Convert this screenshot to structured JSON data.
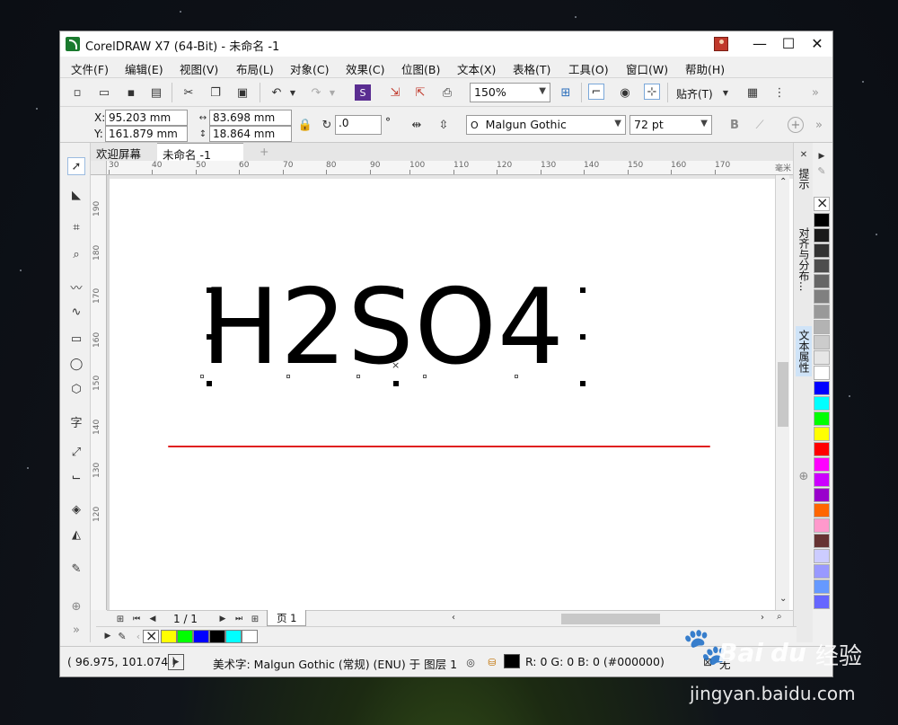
{
  "window": {
    "title": "CorelDRAW X7 (64-Bit) - 未命名 -1",
    "minimize": "—",
    "maximize": "☐",
    "close": "✕"
  },
  "menu": [
    "文件(F)",
    "编辑(E)",
    "视图(V)",
    "布局(L)",
    "对象(C)",
    "效果(C)",
    "位图(B)",
    "文本(X)",
    "表格(T)",
    "工具(O)",
    "窗口(W)",
    "帮助(H)"
  ],
  "toolbar": {
    "zoom": "150%",
    "snap_label": "贴齐(T)",
    "more": "»"
  },
  "propertybar": {
    "x_label": "X:",
    "x_value": "95.203 mm",
    "y_label": "Y:",
    "y_value": "161.879 mm",
    "width_value": "83.698 mm",
    "height_value": "18.864 mm",
    "rotation_value": ".0",
    "rotation_unit": "°",
    "font_name": "Malgun Gothic",
    "font_size": "72 pt"
  },
  "tabs": {
    "welcome": "欢迎屏幕",
    "document": "未命名 -1",
    "add": "+"
  },
  "ruler": {
    "unit": "毫米",
    "h_ticks": [
      "30",
      "40",
      "50",
      "60",
      "70",
      "80",
      "90",
      "100",
      "110",
      "120",
      "130",
      "140",
      "150",
      "160",
      "170"
    ],
    "v_ticks": [
      "190",
      "180",
      "170",
      "160",
      "150",
      "140",
      "130",
      "120"
    ]
  },
  "canvas": {
    "text": "H2SO4",
    "line_color": "#e02020"
  },
  "dockers": {
    "hints": "提示",
    "align": "对齐与分布...",
    "text_props": "文本属性"
  },
  "palette": [
    "#000000",
    "#1a1a1a",
    "#333333",
    "#4d4d4d",
    "#666666",
    "#808080",
    "#999999",
    "#b3b3b3",
    "#cccccc",
    "#e6e6e6",
    "#ffffff",
    "#0000ff",
    "#00ffff",
    "#00ff00",
    "#ffff00",
    "#ff0000",
    "#ff00ff",
    "#cc00ff",
    "#9900cc",
    "#ff6600",
    "#ff99cc",
    "#663333",
    "#ccccff",
    "#9999ff",
    "#6699ff",
    "#6666ff"
  ],
  "pagebar": {
    "page_count": "1 / 1",
    "page_tab": "页 1"
  },
  "docpalette": [
    "#ffff00",
    "#00ff00",
    "#0000ff",
    "#000000",
    "#00ffff",
    "#ffffff"
  ],
  "status": {
    "coords": "( 96.975, 101.074 )",
    "object_info": "美术字: Malgun Gothic (常规) (ENU) 于 图层 1",
    "fill_info": "R: 0 G: 0 B: 0 (#000000)",
    "outline_label": "无"
  },
  "watermark": {
    "brand_latin": "Bai",
    "brand_du": "du",
    "brand_cn": "经验",
    "url": "jingyan.baidu.com"
  }
}
